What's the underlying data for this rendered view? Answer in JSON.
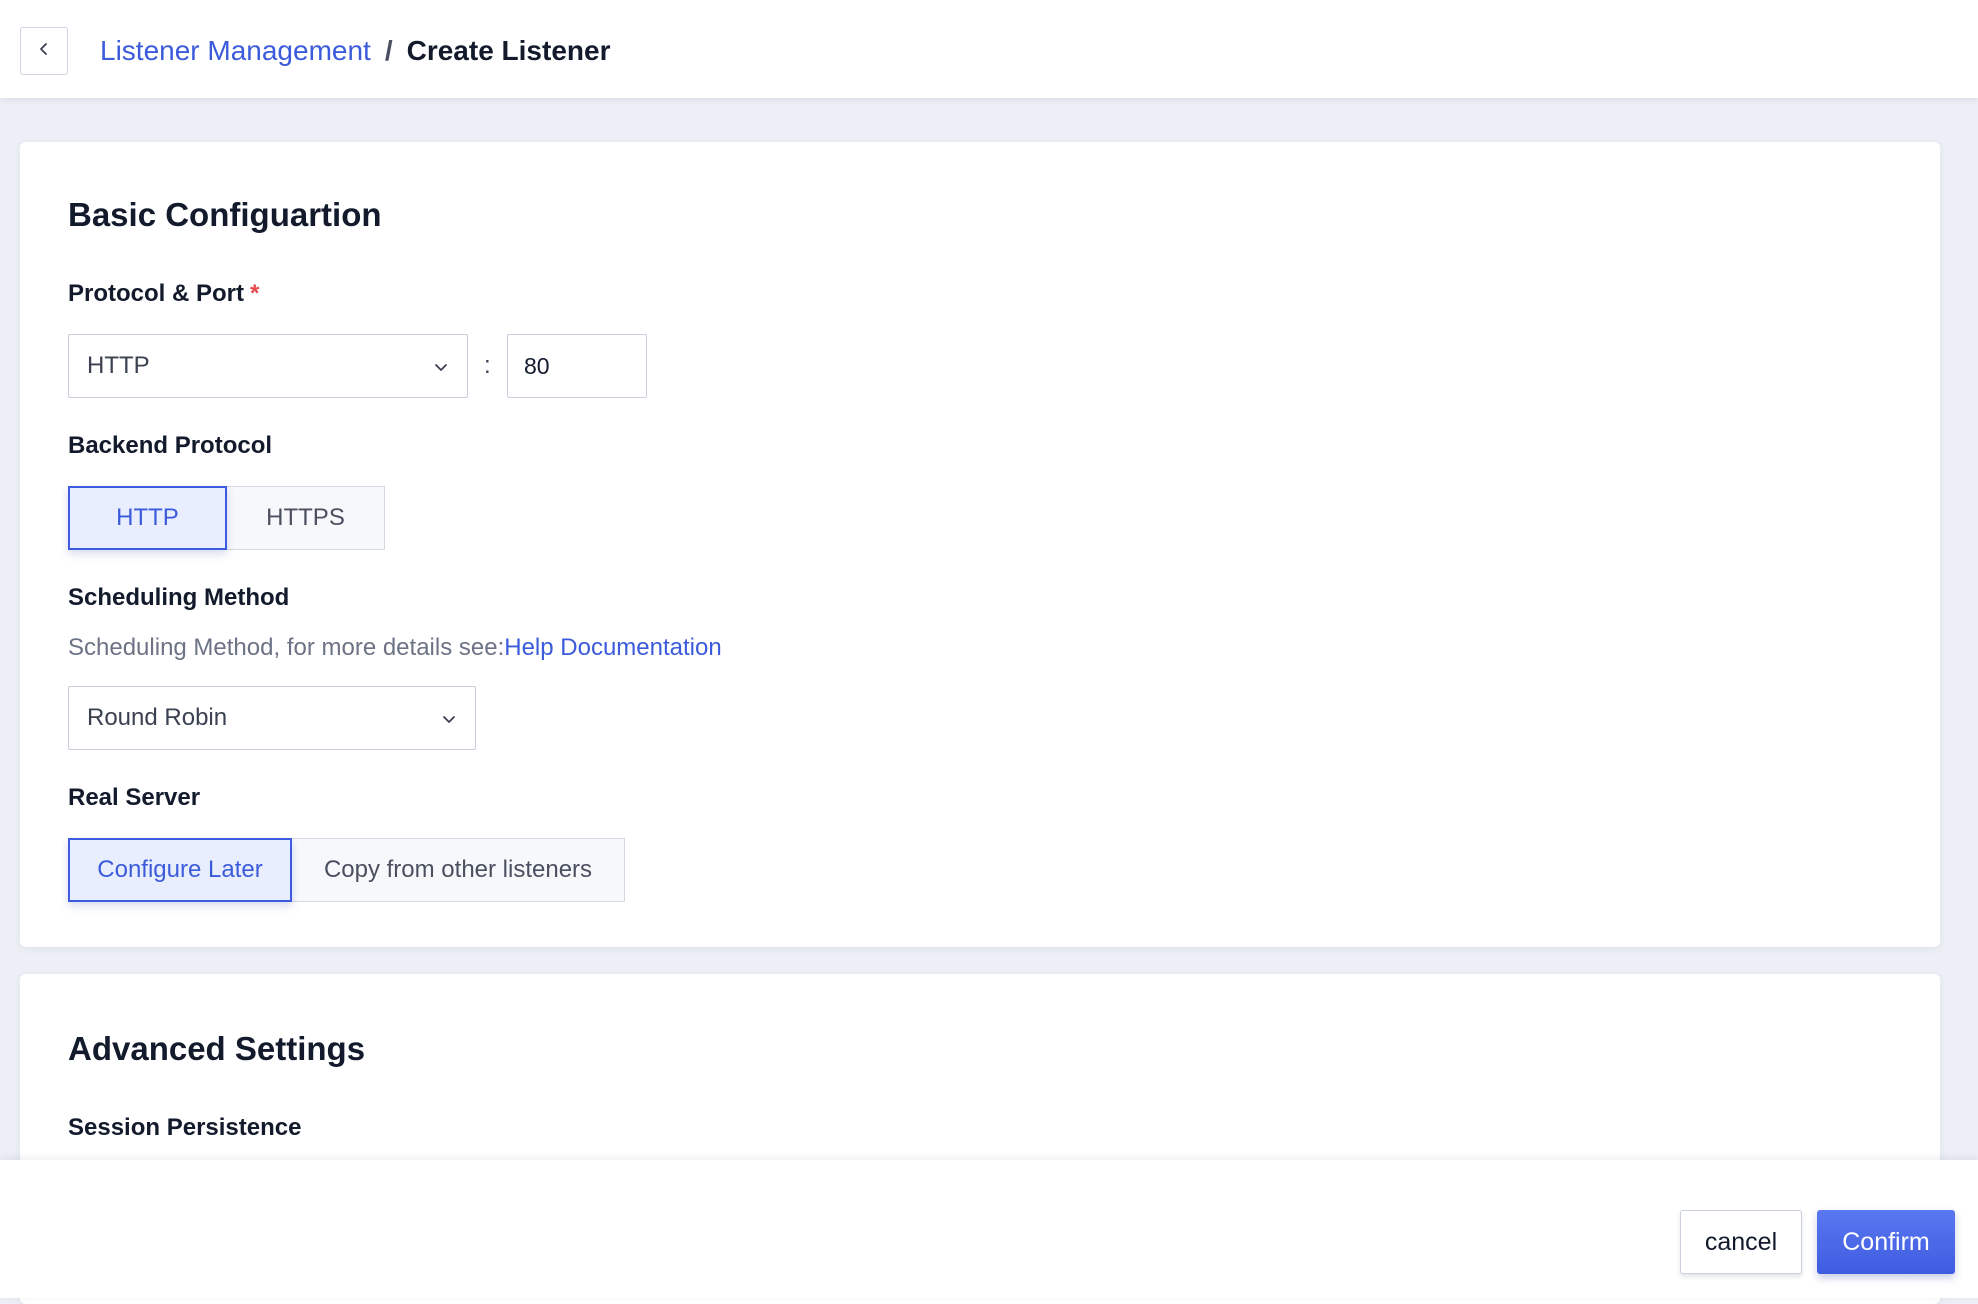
{
  "header": {
    "breadcrumb_parent": "Listener Management",
    "breadcrumb_separator": "/",
    "breadcrumb_current": "Create Listener"
  },
  "basic": {
    "title": "Basic Configuartion",
    "protocol_port": {
      "label": "Protocol & Port",
      "required_mark": "*",
      "protocol_value": "HTTP",
      "separator": ":",
      "port_value": "80"
    },
    "backend_protocol": {
      "label": "Backend Protocol",
      "options": [
        "HTTP",
        "HTTPS"
      ],
      "selected": "HTTP"
    },
    "scheduling": {
      "label": "Scheduling Method",
      "help_prefix": "Scheduling Method, for more details see:",
      "help_link": "Help Documentation",
      "value": "Round Robin"
    },
    "real_server": {
      "label": "Real Server",
      "options": [
        "Configure Later",
        "Copy from other listeners"
      ],
      "selected": "Configure Later"
    }
  },
  "advanced": {
    "title": "Advanced Settings",
    "session_persistence_label": "Session Persistence"
  },
  "footer": {
    "cancel_label": "cancel",
    "confirm_label": "Confirm"
  },
  "colors": {
    "accent": "#3b5bdb",
    "required": "#e5484d",
    "background": "#edeff6"
  }
}
